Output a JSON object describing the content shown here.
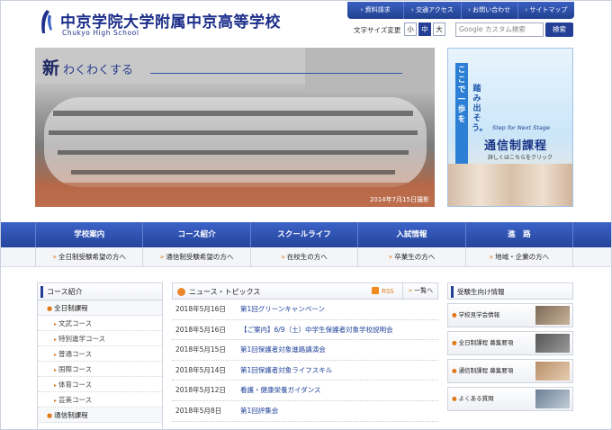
{
  "header": {
    "title": "中京学院大学附属中京高等学校",
    "subtitle": "Chukyo High School",
    "top_links": [
      "資料請求",
      "交通アクセス",
      "お問い合わせ",
      "サイトマップ"
    ],
    "font_size_label": "文字サイズ変更",
    "font_sizes": [
      "小",
      "中",
      "大"
    ],
    "font_size_selected": "中",
    "search_placeholder": "Google カスタム検索",
    "search_button": "検索"
  },
  "hero": {
    "tagline_big": "新",
    "tagline_small": "わくわくする",
    "date_caption": "2014年7月15日撮影"
  },
  "side_banner": {
    "vertical_badge": "ここで一歩を",
    "vertical_text": "踏み出そう。",
    "step_text": "Step for Next Stage",
    "heading": "通信制課程",
    "click_text": "詳しくはこちらをクリック"
  },
  "main_nav": [
    "学校案内",
    "コース紹介",
    "スクールライフ",
    "入試情報",
    "進　路"
  ],
  "sub_nav": [
    "全日制受験希望の方へ",
    "通信制受験希望の方へ",
    "在校生の方へ",
    "卒業生の方へ",
    "地域・企業の方へ"
  ],
  "course_box": {
    "heading": "コース紹介",
    "categories": [
      {
        "label": "全日制課程",
        "items": [
          "文武コース",
          "特別進学コース",
          "普通コース",
          "国際コース",
          "体育コース",
          "芸美コース"
        ]
      },
      {
        "label": "通信制課程",
        "items": []
      }
    ]
  },
  "news": {
    "heading": "ニュース・トピックス",
    "rss_label": "RSS",
    "list_label": "一覧へ",
    "items": [
      {
        "date": "2018年5月16日",
        "title": "第1回グリーンキャンペーン"
      },
      {
        "date": "2018年5月16日",
        "title": "【ご案内】6/9（土）中学生保護者対象学校説明会"
      },
      {
        "date": "2018年5月15日",
        "title": "第1回保護者対象進路講演会"
      },
      {
        "date": "2018年5月14日",
        "title": "第1回保護者対象ライフスキル"
      },
      {
        "date": "2018年5月12日",
        "title": "看護・健康栄養ガイダンス"
      },
      {
        "date": "2018年5月8日",
        "title": "第1回評集会"
      }
    ]
  },
  "exam_box": {
    "heading": "受験生向け情報",
    "items": [
      "学校見学会情報",
      "全日制課程 募集要項",
      "通信制課程 募集要項",
      "よくある質問"
    ]
  }
}
